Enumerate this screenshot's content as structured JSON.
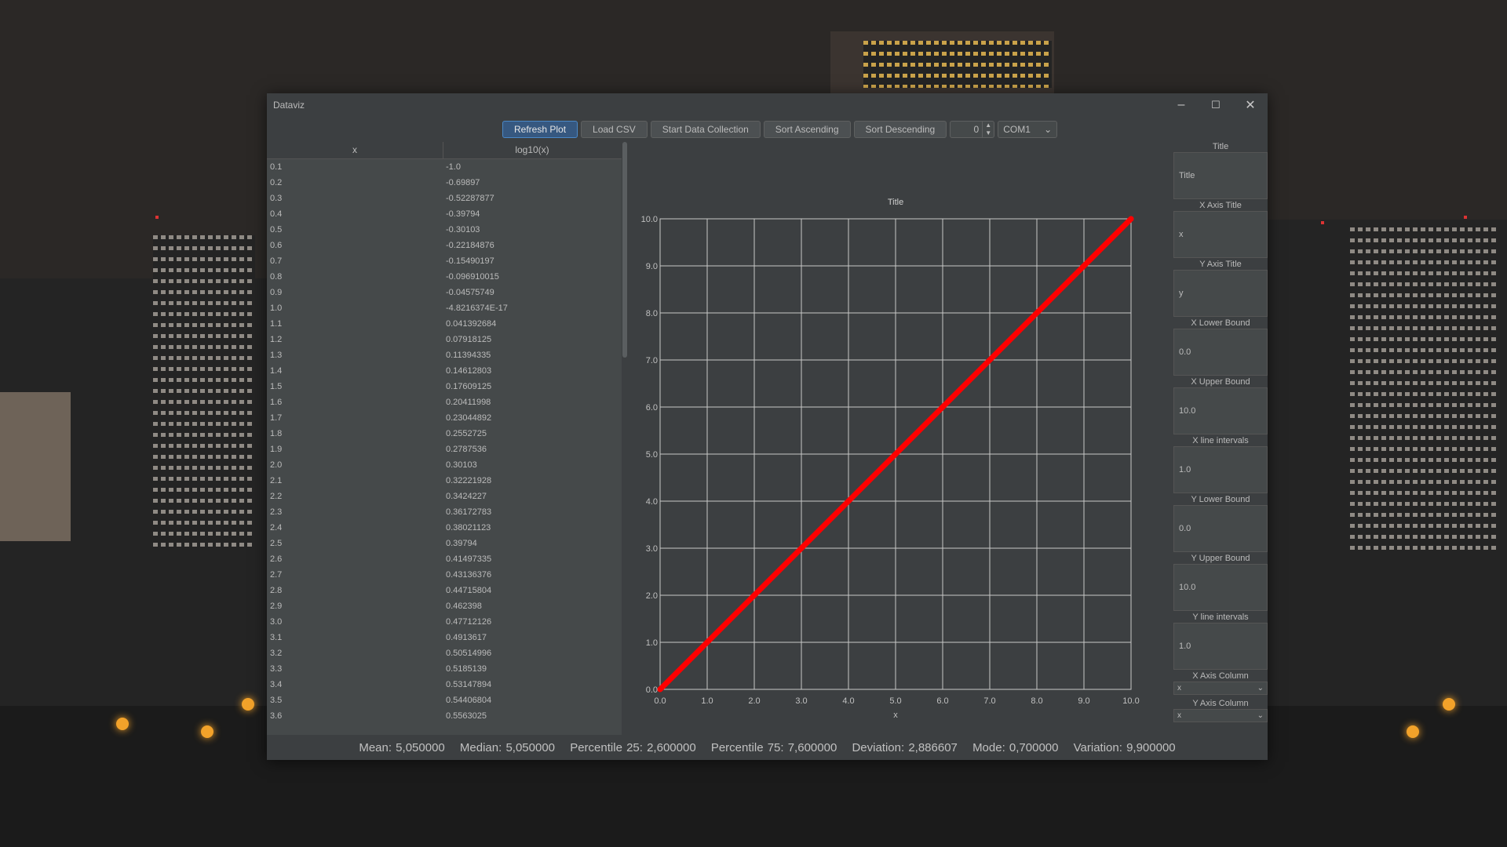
{
  "window": {
    "title": "Dataviz"
  },
  "toolbar": {
    "refresh": "Refresh Plot",
    "load_csv": "Load CSV",
    "start": "Start Data Collection",
    "sort_asc": "Sort Ascending",
    "sort_desc": "Sort Descending",
    "spinner_value": "0",
    "port": "COM1"
  },
  "table": {
    "headers": [
      "x",
      "log10(x)"
    ],
    "rows": [
      [
        "0.1",
        "-1.0"
      ],
      [
        "0.2",
        "-0.69897"
      ],
      [
        "0.3",
        "-0.52287877"
      ],
      [
        "0.4",
        "-0.39794"
      ],
      [
        "0.5",
        "-0.30103"
      ],
      [
        "0.6",
        "-0.22184876"
      ],
      [
        "0.7",
        "-0.15490197"
      ],
      [
        "0.8",
        "-0.096910015"
      ],
      [
        "0.9",
        "-0.04575749"
      ],
      [
        "1.0",
        "-4.8216374E-17"
      ],
      [
        "1.1",
        "0.041392684"
      ],
      [
        "1.2",
        "0.07918125"
      ],
      [
        "1.3",
        "0.11394335"
      ],
      [
        "1.4",
        "0.14612803"
      ],
      [
        "1.5",
        "0.17609125"
      ],
      [
        "1.6",
        "0.20411998"
      ],
      [
        "1.7",
        "0.23044892"
      ],
      [
        "1.8",
        "0.2552725"
      ],
      [
        "1.9",
        "0.2787536"
      ],
      [
        "2.0",
        "0.30103"
      ],
      [
        "2.1",
        "0.32221928"
      ],
      [
        "2.2",
        "0.3424227"
      ],
      [
        "2.3",
        "0.36172783"
      ],
      [
        "2.4",
        "0.38021123"
      ],
      [
        "2.5",
        "0.39794"
      ],
      [
        "2.6",
        "0.41497335"
      ],
      [
        "2.7",
        "0.43136376"
      ],
      [
        "2.8",
        "0.44715804"
      ],
      [
        "2.9",
        "0.462398"
      ],
      [
        "3.0",
        "0.47712126"
      ],
      [
        "3.1",
        "0.4913617"
      ],
      [
        "3.2",
        "0.50514996"
      ],
      [
        "3.3",
        "0.5185139"
      ],
      [
        "3.4",
        "0.53147894"
      ],
      [
        "3.5",
        "0.54406804"
      ],
      [
        "3.6",
        "0.5563025"
      ]
    ]
  },
  "chart_data": {
    "type": "line",
    "title": "Title",
    "xlabel": "x",
    "ylabel": "",
    "xlim": [
      0,
      10
    ],
    "ylim": [
      0,
      10
    ],
    "grid": true,
    "xticks": [
      "0.0",
      "1.0",
      "2.0",
      "3.0",
      "4.0",
      "5.0",
      "6.0",
      "7.0",
      "8.0",
      "9.0",
      "10.0"
    ],
    "yticks": [
      "0.0",
      "1.0",
      "2.0",
      "3.0",
      "4.0",
      "5.0",
      "6.0",
      "7.0",
      "8.0",
      "9.0",
      "10.0"
    ],
    "series": [
      {
        "color": "#ff0000",
        "x": [
          0,
          1,
          2,
          3,
          4,
          5,
          6,
          7,
          8,
          9,
          10
        ],
        "y": [
          0,
          1,
          2,
          3,
          4,
          5,
          6,
          7,
          8,
          9,
          10
        ]
      }
    ]
  },
  "settings": {
    "title_label": "Title",
    "title_value": "Title",
    "xaxis_label": "X Axis Title",
    "xaxis_value": "x",
    "yaxis_label": "Y Axis Title",
    "yaxis_value": "y",
    "xlow_label": "X Lower Bound",
    "xlow_value": "0.0",
    "xup_label": "X Upper Bound",
    "xup_value": "10.0",
    "xint_label": "X line intervals",
    "xint_value": "1.0",
    "ylow_label": "Y Lower Bound",
    "ylow_value": "0.0",
    "yup_label": "Y Upper Bound",
    "yup_value": "10.0",
    "yint_label": "Y line intervals",
    "yint_value": "1.0",
    "xcol_label": "X Axis Column",
    "xcol_value": "x",
    "ycol_label": "Y Axis Column",
    "ycol_value": "x"
  },
  "status": {
    "mean": "Mean: 5,050000",
    "median": "Median: 5,050000",
    "p25": "Percentile 25: 2,600000",
    "p75": "Percentile 75: 7,600000",
    "deviation": "Deviation: 2,886607",
    "mode": "Mode: 0,700000",
    "variation": "Variation: 9,900000"
  }
}
